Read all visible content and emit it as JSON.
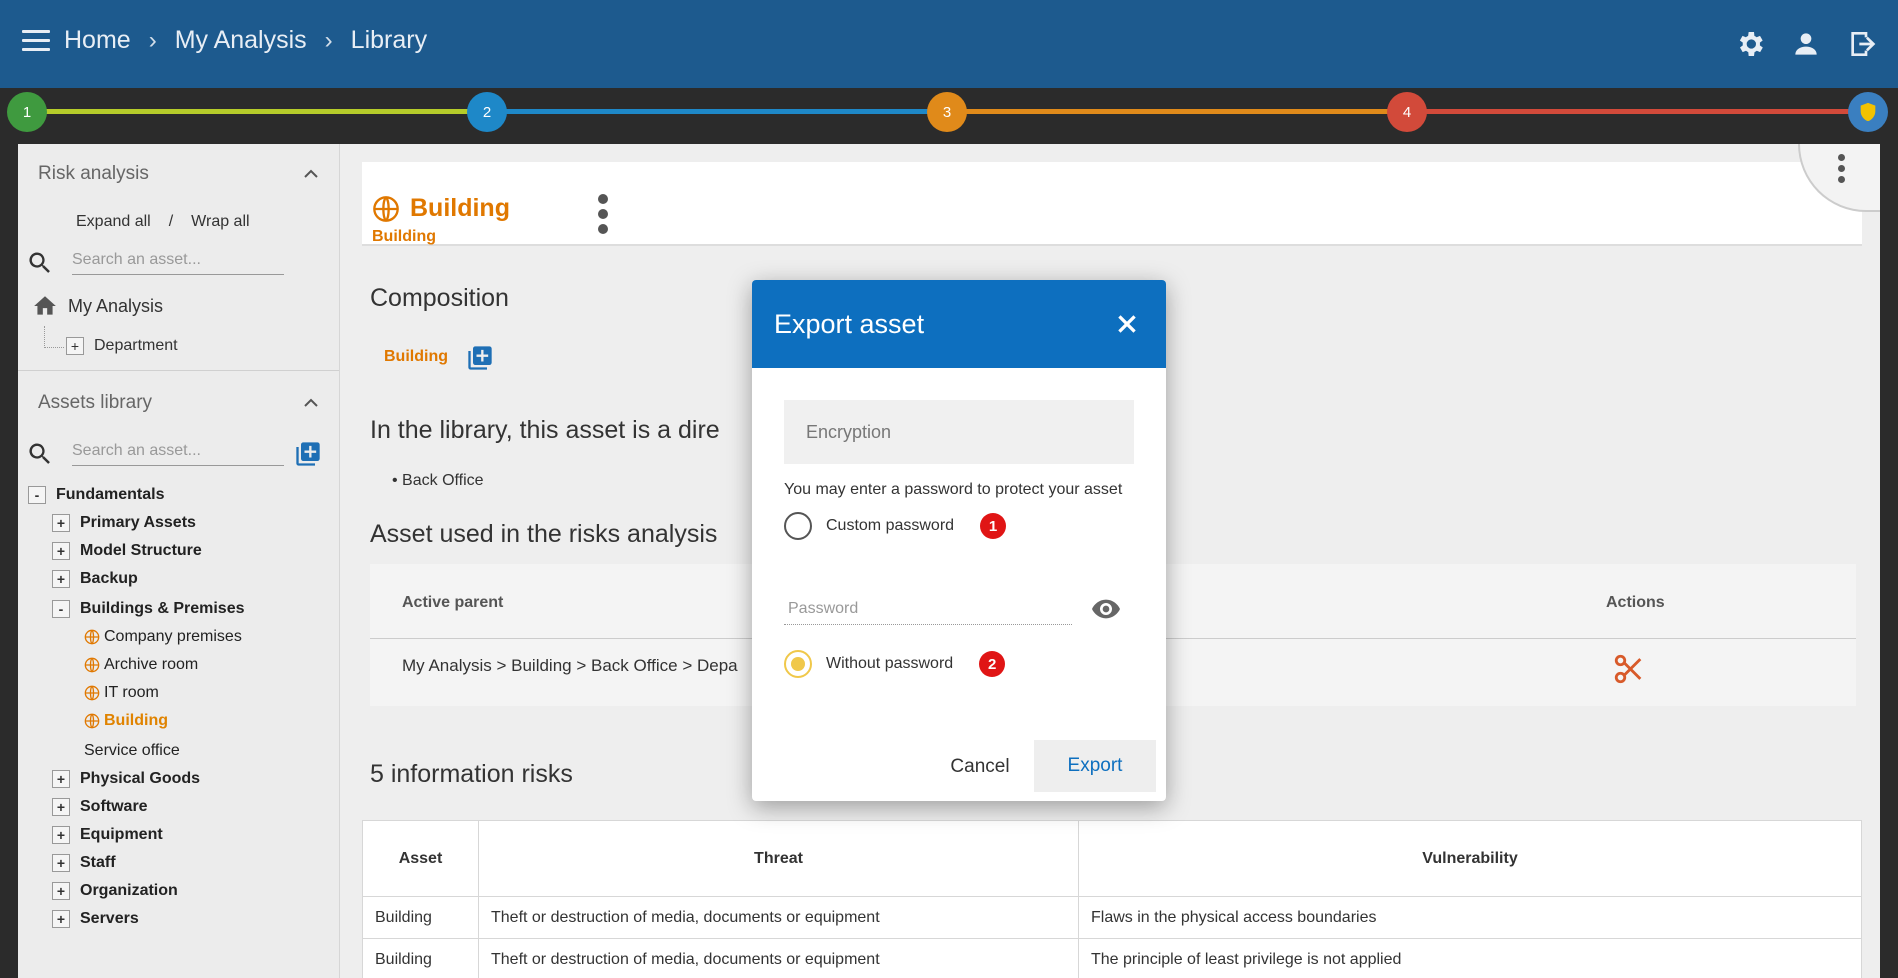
{
  "breadcrumbs": [
    "Home",
    "My Analysis",
    "Library"
  ],
  "stepper": {
    "steps": [
      {
        "label": "1",
        "color": "#3f9a3f"
      },
      {
        "label": "2",
        "color": "#1e88c8"
      },
      {
        "label": "3",
        "color": "#e08a1a"
      },
      {
        "label": "4",
        "color": "#d24a3a"
      }
    ],
    "line_colors": [
      "#b6cc2a",
      "#1e88c8",
      "#e08a1a",
      "#d24a3a"
    ]
  },
  "sidebar": {
    "risk_analysis": {
      "title": "Risk analysis",
      "expand_all": "Expand all",
      "slash": "/",
      "wrap_all": "Wrap all",
      "search_placeholder": "Search an asset...",
      "root": "My Analysis",
      "child": "Department"
    },
    "assets_library": {
      "title": "Assets library",
      "search_placeholder": "Search an asset...",
      "tree": [
        {
          "label": "Fundamentals",
          "toggle": "-",
          "level": 0,
          "bold": true
        },
        {
          "label": "Primary Assets",
          "toggle": "+",
          "level": 1,
          "bold": true
        },
        {
          "label": "Model Structure",
          "toggle": "+",
          "level": 1,
          "bold": true
        },
        {
          "label": "Backup",
          "toggle": "+",
          "level": 1,
          "bold": true
        },
        {
          "label": "Buildings & Premises",
          "toggle": "-",
          "level": 1,
          "bold": true
        },
        {
          "label": "Company premises",
          "level": 2,
          "globe": true
        },
        {
          "label": "Archive room",
          "level": 2,
          "globe": true
        },
        {
          "label": "IT room",
          "level": 2,
          "globe": true
        },
        {
          "label": "Building",
          "level": 2,
          "globe": true,
          "selected": true
        },
        {
          "label": "Service office",
          "level": 2
        },
        {
          "label": "Physical Goods",
          "toggle": "+",
          "level": 1,
          "bold": true
        },
        {
          "label": "Software",
          "toggle": "+",
          "level": 1,
          "bold": true
        },
        {
          "label": "Equipment",
          "toggle": "+",
          "level": 1,
          "bold": true
        },
        {
          "label": "Staff",
          "toggle": "+",
          "level": 1,
          "bold": true
        },
        {
          "label": "Organization",
          "toggle": "+",
          "level": 1,
          "bold": true
        },
        {
          "label": "Servers",
          "toggle": "+",
          "level": 1,
          "bold": true
        }
      ]
    }
  },
  "main": {
    "asset_title": "Building",
    "asset_sub": "Building",
    "composition_title": "Composition",
    "composition_item": "Building",
    "library_text": "In the library, this asset is a dire",
    "library_item": "Back Office",
    "used_title": "Asset used in the risks analysis",
    "col_active_parent": "Active parent",
    "col_actions": "Actions",
    "used_row": "My Analysis > Building > Back Office > Depa",
    "risks_title": "5 information risks",
    "risk_table": {
      "headers": [
        "Asset",
        "Threat",
        "Vulnerability"
      ],
      "rows": [
        [
          "Building",
          "Theft or destruction of media, documents or equipment",
          "Flaws in the physical access boundaries"
        ],
        [
          "Building",
          "Theft or destruction of media, documents or equipment",
          "The principle of least privilege is not applied"
        ]
      ]
    }
  },
  "modal": {
    "title": "Export asset",
    "encryption_label": "Encryption",
    "hint": "You may enter a password to protect your asset",
    "option_custom": "Custom password",
    "option_custom_badge": "1",
    "password_placeholder": "Password",
    "option_without": "Without password",
    "option_without_badge": "2",
    "selected": "without",
    "cancel": "Cancel",
    "export": "Export"
  }
}
